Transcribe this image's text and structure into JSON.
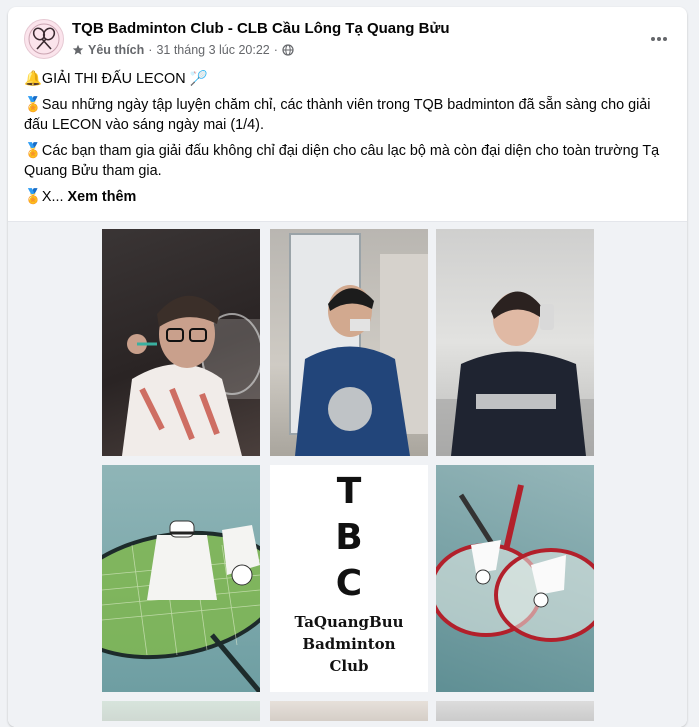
{
  "post": {
    "page_name": "TQB Badminton Club - CLB Cầu Lông Tạ Quang Bửu",
    "favorite_label": "Yêu thích",
    "separator": "·",
    "timestamp": "31 tháng 3 lúc 20:22",
    "icons": {
      "favorite": "star-icon",
      "audience": "globe-icon",
      "more": "more-options-icon"
    }
  },
  "content": {
    "line1": "GIẢI THI ĐẤU LECON",
    "line2": "Sau những ngày tập luyện chăm chỉ, các thành viên trong TQB badminton đã sẵn sàng cho giải đấu LECON vào sáng ngày mai (1/4).",
    "line3": "Các bạn tham gia giải đấu không chỉ đại diện cho câu lạc bộ mà còn đại diện cho toàn trường Tạ Quang Bửu tham gia.",
    "line4_prefix": "X...",
    "see_more": "Xem thêm"
  },
  "gallery": {
    "logo_letters": [
      "T",
      "B",
      "C"
    ],
    "logo_sub": [
      "TaQuangBuu",
      "Badminton",
      "Club"
    ]
  },
  "colors": {
    "background": "#f0f2f5",
    "card": "#ffffff",
    "secondary_text": "#65676b"
  }
}
